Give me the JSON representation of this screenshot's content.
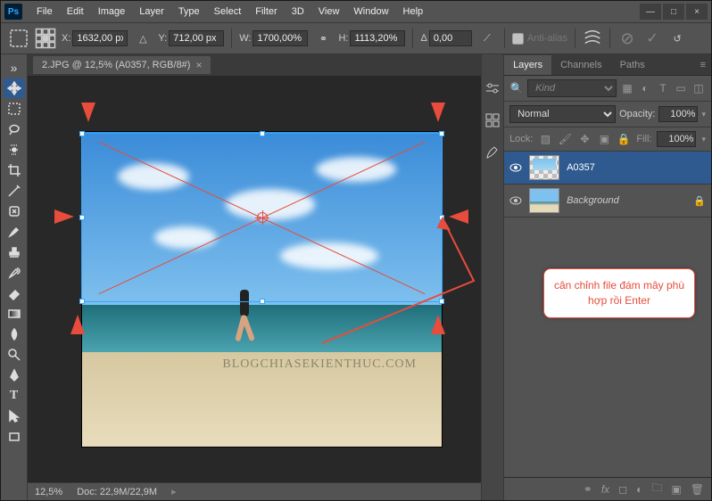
{
  "menu": [
    "File",
    "Edit",
    "Image",
    "Layer",
    "Type",
    "Select",
    "Filter",
    "3D",
    "View",
    "Window",
    "Help"
  ],
  "window_controls": {
    "min": "—",
    "max": "□",
    "close": "×"
  },
  "options": {
    "x_label": "X:",
    "x": "1632,00 px",
    "y_label": "Y:",
    "y": "712,00 px",
    "w_label": "W:",
    "w": "1700,00%",
    "h_label": "H:",
    "h": "1113,20%",
    "angle_label": "Δ",
    "angle": "0,00",
    "antialias": "Anti-alias"
  },
  "doc_tab": "2.JPG @ 12,5% (A0357, RGB/8#)",
  "status": {
    "zoom": "12,5%",
    "doc": "Doc: 22,9M/22,9M"
  },
  "panel_tabs": [
    "Layers",
    "Channels",
    "Paths"
  ],
  "filter_placeholder": "Kind",
  "blend": {
    "mode": "Normal",
    "opacity_label": "Opacity:",
    "opacity": "100%",
    "fill_label": "Fill:",
    "fill": "100%"
  },
  "lock_label": "Lock:",
  "layers": [
    {
      "name": "A0357",
      "italic": false,
      "locked": false,
      "selected": true,
      "thumb": "checker"
    },
    {
      "name": "Background",
      "italic": true,
      "locked": true,
      "selected": false,
      "thumb": "bg"
    }
  ],
  "callout": "cân chỉnh file đám mây phù hợp rồi Enter",
  "watermark": "BLOGCHIASEKIENTHUC.COM"
}
